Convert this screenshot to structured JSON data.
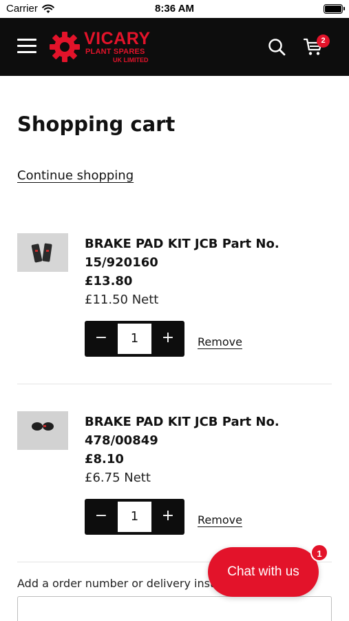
{
  "status_bar": {
    "carrier": "Carrier",
    "time": "8:36 AM",
    "icons": [
      "wifi-icon",
      "battery-icon"
    ]
  },
  "header": {
    "logo": {
      "name": "VICARY",
      "line2": "PLANT SPARES",
      "line3": "UK LIMITED",
      "color": "#e3132a"
    },
    "cart_count": "2",
    "icons": [
      "menu-icon",
      "gear-logo-icon",
      "search-icon",
      "cart-icon"
    ]
  },
  "page": {
    "title": "Shopping cart",
    "continue_label": "Continue shopping"
  },
  "cart": {
    "items": [
      {
        "name": "BRAKE PAD KIT JCB Part No. 15/920160",
        "price": "£13.80",
        "nett": "£11.50 Nett",
        "quantity": "1",
        "minus": "−",
        "plus": "+",
        "remove_label": "Remove"
      },
      {
        "name": "BRAKE PAD KIT JCB Part No. 478/00849",
        "price": "£8.10",
        "nett": "£6.75 Nett",
        "quantity": "1",
        "minus": "−",
        "plus": "+",
        "remove_label": "Remove"
      }
    ]
  },
  "instructions": {
    "label": "Add a order number or delivery instructions"
  },
  "chat": {
    "label": "Chat with us",
    "badge": "1"
  },
  "colors": {
    "brand_red": "#e3132a",
    "header_bg": "#0d0d0d"
  }
}
